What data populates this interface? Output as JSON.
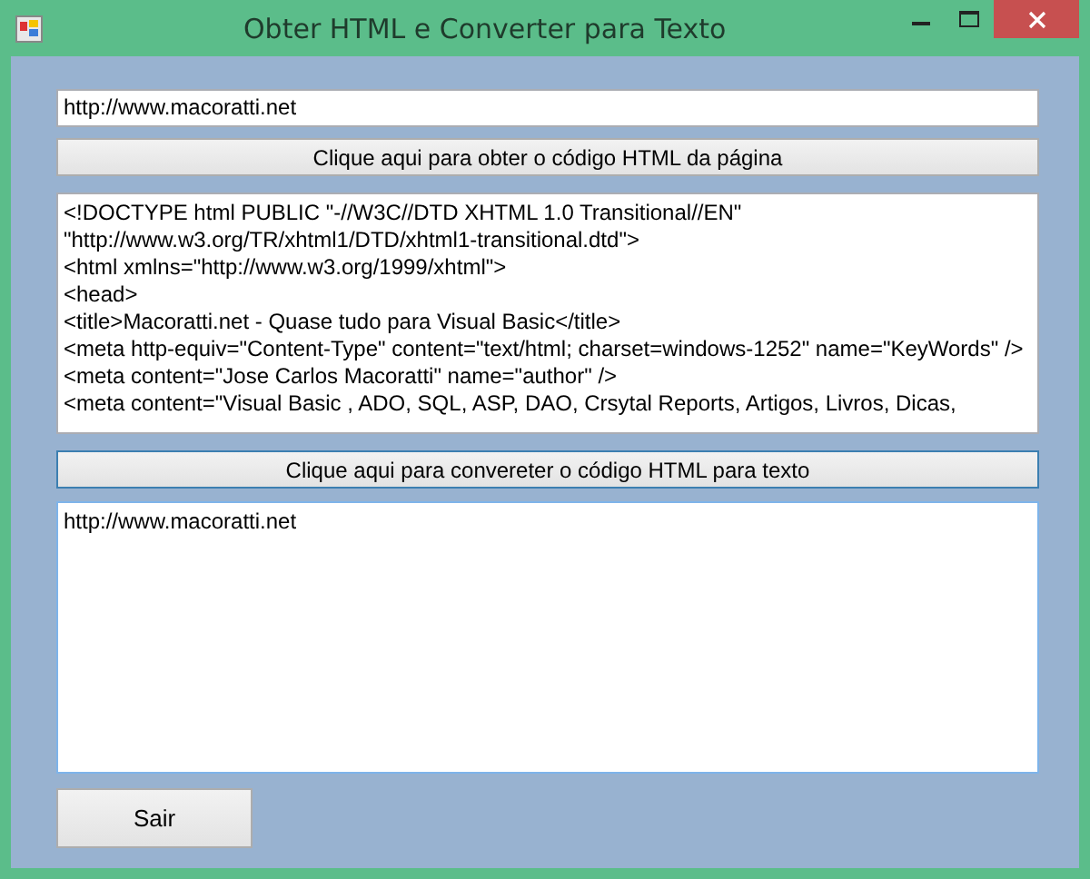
{
  "window": {
    "title": "Obter HTML e Converter para Texto"
  },
  "url_field": {
    "value": "http://www.macoratti.net"
  },
  "get_button": {
    "label": "Clique aqui para obter o código HTML da página",
    "focused": false
  },
  "html_box": {
    "lines": [
      "<!DOCTYPE html PUBLIC \"-//W3C//DTD XHTML 1.0 Transitional//EN\"",
      "\"http://www.w3.org/TR/xhtml1/DTD/xhtml1-transitional.dtd\">",
      "<html xmlns=\"http://www.w3.org/1999/xhtml\">",
      "<head>",
      "<title>Macoratti.net - Quase tudo para Visual Basic</title>",
      "<meta http-equiv=\"Content-Type\" content=\"text/html; charset=windows-1252\" name=\"KeyWords\" />",
      "<meta content=\"Jose Carlos Macoratti\" name=\"author\" />",
      "<meta content=\"Visual Basic , ADO, SQL, ASP, DAO, Crsytal Reports, Artigos, Livros, Dicas,"
    ]
  },
  "convert_button": {
    "label": "Clique aqui para convereter o código HTML para texto",
    "focused": true
  },
  "text_box": {
    "lines": [
      "http://www.macoratti.net"
    ]
  },
  "exit_button": {
    "label": "Sair",
    "focused": false
  }
}
